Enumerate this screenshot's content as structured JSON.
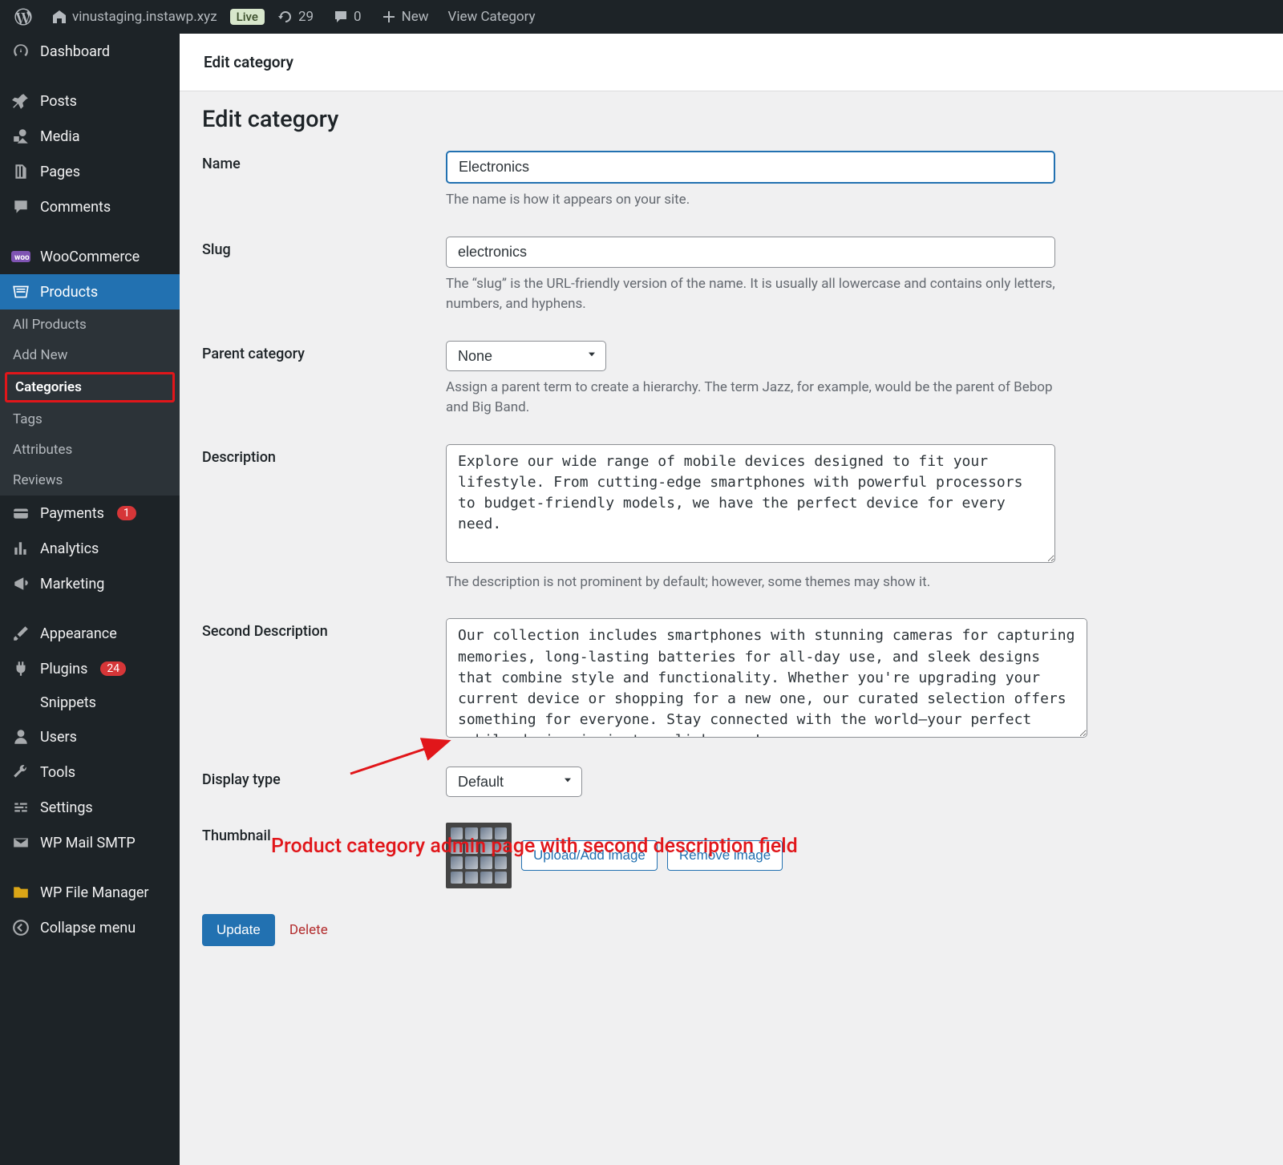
{
  "adminbar": {
    "site_name": "vinustaging.instawp.xyz",
    "live_label": "Live",
    "revisions_count": "29",
    "comments_count": "0",
    "new_label": "New",
    "view_link": "View Category"
  },
  "sidebar": {
    "dashboard": "Dashboard",
    "posts": "Posts",
    "media": "Media",
    "pages": "Pages",
    "comments": "Comments",
    "woocommerce": "WooCommerce",
    "products": "Products",
    "products_sub": {
      "all": "All Products",
      "add_new": "Add New",
      "categories": "Categories",
      "tags": "Tags",
      "attributes": "Attributes",
      "reviews": "Reviews"
    },
    "payments": "Payments",
    "payments_badge": "1",
    "analytics": "Analytics",
    "marketing": "Marketing",
    "appearance": "Appearance",
    "plugins": "Plugins",
    "plugins_badge": "24",
    "snippets": "Snippets",
    "users": "Users",
    "tools": "Tools",
    "settings": "Settings",
    "wpmail": "WP Mail SMTP",
    "wpfile": "WP File Manager",
    "collapse": "Collapse menu"
  },
  "page": {
    "header_title": "Edit category",
    "title": "Edit category"
  },
  "form": {
    "name_label": "Name",
    "name_value": "Electronics",
    "name_help": "The name is how it appears on your site.",
    "slug_label": "Slug",
    "slug_value": "electronics",
    "slug_help": "The “slug” is the URL-friendly version of the name. It is usually all lowercase and contains only letters, numbers, and hyphens.",
    "parent_label": "Parent category",
    "parent_value": "None",
    "parent_help": "Assign a parent term to create a hierarchy. The term Jazz, for example, would be the parent of Bebop and Big Band.",
    "desc_label": "Description",
    "desc_value": "Explore our wide range of mobile devices designed to fit your lifestyle. From cutting-edge smartphones with powerful processors to budget-friendly models, we have the perfect device for every need.",
    "desc_help": "The description is not prominent by default; however, some themes may show it.",
    "second_desc_label": "Second Description",
    "second_desc_value": "Our collection includes smartphones with stunning cameras for capturing memories, long-lasting batteries for all-day use, and sleek designs that combine style and functionality. Whether you're upgrading your current device or shopping for a new one, our curated selection offers something for everyone. Stay connected with the world—your perfect mobile device is just a click away!",
    "display_label": "Display type",
    "display_value": "Default",
    "thumb_label": "Thumbnail",
    "upload_btn": "Upload/Add image",
    "remove_btn": "Remove image"
  },
  "actions": {
    "update": "Update",
    "delete": "Delete"
  },
  "annotation": {
    "text": "Product category admin page with second description field"
  }
}
